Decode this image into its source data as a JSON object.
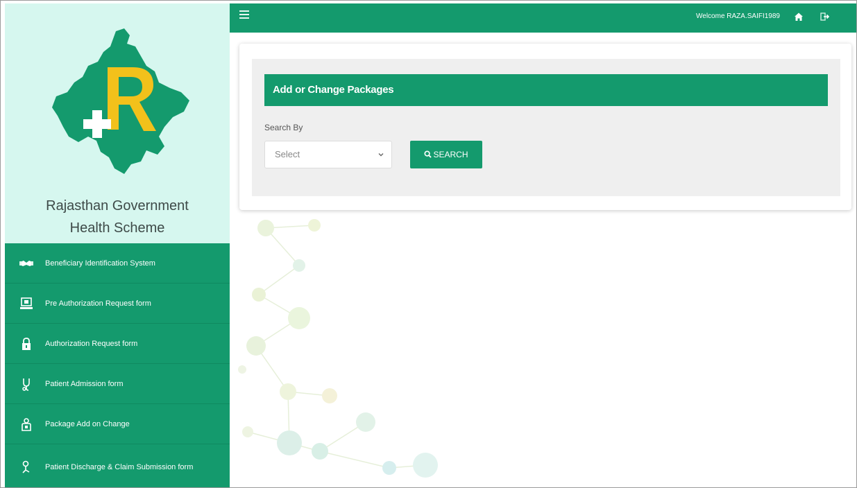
{
  "topbar": {
    "menu_icon": "hamburger-icon",
    "welcome_text": "Welcome RAZA.SAIFI1989",
    "home_icon": "home-icon",
    "logout_icon": "logout-icon"
  },
  "brand": {
    "title_line1": "Rajasthan Government",
    "title_line2": "Health Scheme",
    "logo_icon": "rajasthan-map-logo"
  },
  "sidebar": {
    "items": [
      {
        "label": "Beneficiary Identification System",
        "icon": "handshake-icon"
      },
      {
        "label": "Pre Authorization Request form",
        "icon": "monitor-icon"
      },
      {
        "label": "Authorization Request form",
        "icon": "lock-icon"
      },
      {
        "label": "Patient Admission form",
        "icon": "stethoscope-icon"
      },
      {
        "label": "Package Add on Change",
        "icon": "package-icon"
      },
      {
        "label": "Patient Discharge & Claim Submission form",
        "icon": "discharge-icon"
      }
    ]
  },
  "panel": {
    "heading": "Add or Change Packages",
    "search_label": "Search By",
    "select_value": "Select",
    "search_button": "SEARCH",
    "search_icon": "search-icon"
  },
  "colors": {
    "primary_green": "#149a6d",
    "brand_bg": "#d6f7ef",
    "logo_yellow": "#f2c11b"
  }
}
